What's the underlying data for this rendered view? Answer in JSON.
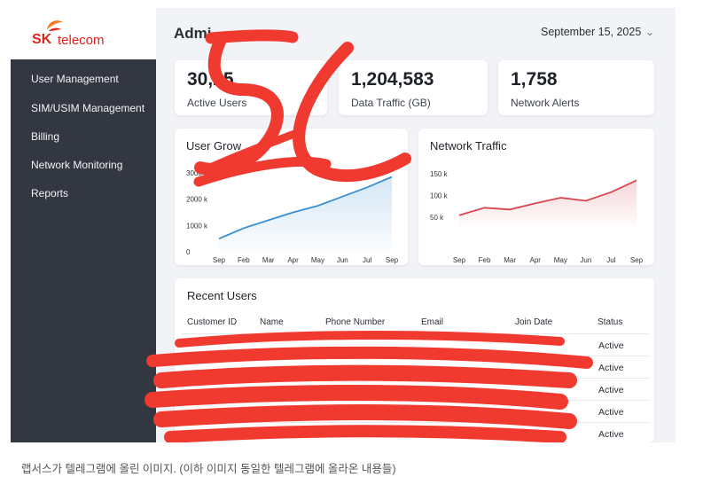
{
  "app": {
    "logo_sk": "SK",
    "logo_telecom": "telecom",
    "title": "Admi"
  },
  "sidebar": {
    "items": [
      {
        "label": "User Management"
      },
      {
        "label": "SIM/USIM Management"
      },
      {
        "label": "Billing"
      },
      {
        "label": "Network Monitoring"
      },
      {
        "label": "Reports"
      }
    ]
  },
  "header": {
    "date": "September 15, 2025",
    "chevron_icon": "chevron-down-icon"
  },
  "stats": [
    {
      "value": "30,25",
      "label": "Active Users"
    },
    {
      "value": "1,204,583",
      "label": "Data Traffic (GB)"
    },
    {
      "value": "1,758",
      "label": "Network Alerts"
    }
  ],
  "chart_data": [
    {
      "type": "area",
      "title": "User Grow",
      "x": [
        "Sep",
        "Feb",
        "Mar",
        "Apr",
        "May",
        "Jun",
        "Jul",
        "Sep"
      ],
      "y_ticks": [
        "0",
        "1000 k",
        "2000 k",
        "3000 k"
      ],
      "ylim": [
        0,
        3000
      ],
      "series": [
        {
          "values": [
            500,
            900,
            1200,
            1500,
            1750,
            2100,
            2450,
            2850
          ]
        }
      ],
      "color": "#3a8fd0"
    },
    {
      "type": "area",
      "title": "Network Traffic",
      "x": [
        "Sep",
        "Feb",
        "Mar",
        "Apr",
        "May",
        "Jun",
        "Jul",
        "Sep"
      ],
      "y_ticks": [
        "50 k",
        "100 k",
        "150 k"
      ],
      "ylim": [
        30,
        150
      ],
      "series": [
        {
          "values": [
            55,
            72,
            68,
            82,
            95,
            88,
            108,
            135
          ]
        }
      ],
      "color": "#d9464f"
    }
  ],
  "recent_users": {
    "title": "Recent Users",
    "columns": [
      "Customer ID",
      "Name",
      "Phone Number",
      "Email",
      "Join Date",
      "Status"
    ],
    "rows": [
      {
        "status": "Active"
      },
      {
        "status": "Active"
      },
      {
        "status": "Active"
      },
      {
        "status": "Active"
      },
      {
        "status": "Active"
      }
    ]
  },
  "caption": "랩서스가 텔레그램에 올린 이미지. (이하 이미지 동일한 텔레그램에 올라온 내용들)",
  "colors": {
    "sidebar": "#323741",
    "brand": "#e2231a",
    "scribble": "#f03a30"
  }
}
